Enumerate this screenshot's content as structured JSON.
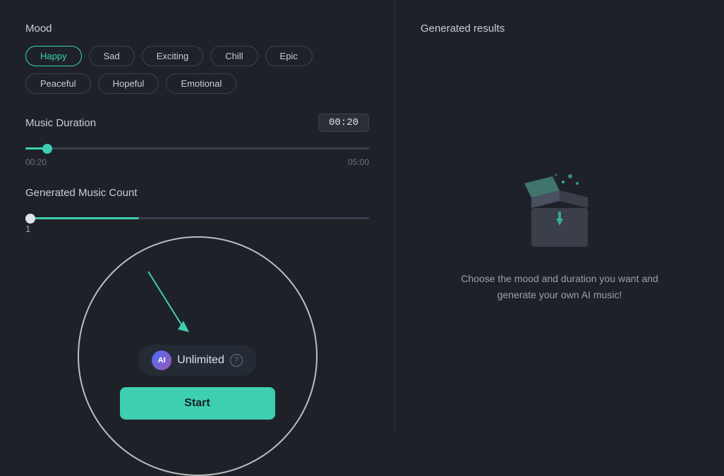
{
  "left": {
    "mood_label": "Mood",
    "moods": [
      {
        "id": "happy",
        "label": "Happy",
        "active": true
      },
      {
        "id": "sad",
        "label": "Sad",
        "active": false
      },
      {
        "id": "exciting",
        "label": "Exciting",
        "active": false
      },
      {
        "id": "chill",
        "label": "Chill",
        "active": false
      },
      {
        "id": "epic",
        "label": "Epic",
        "active": false
      },
      {
        "id": "peaceful",
        "label": "Peaceful",
        "active": false
      },
      {
        "id": "hopeful",
        "label": "Hopeful",
        "active": false
      },
      {
        "id": "emotional",
        "label": "Emotional",
        "active": false
      }
    ],
    "duration_label": "Music Duration",
    "duration_min": "00:20",
    "duration_max": "05:00",
    "duration_value": "00:20",
    "count_label": "Generated Music Count",
    "count_value": "1",
    "unlimited_text": "Unlimited",
    "unlimited_icon": "AI",
    "help_icon": "?",
    "start_label": "Start"
  },
  "right": {
    "title": "Generated results",
    "empty_text": "Choose the mood and duration you want and generate your own AI music!"
  }
}
